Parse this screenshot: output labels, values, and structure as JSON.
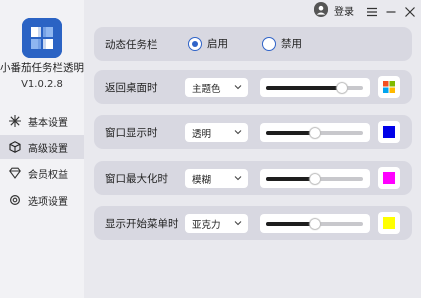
{
  "app": {
    "name": "小番茄任务栏透明",
    "version": "V1.0.2.8",
    "brand_color": "#2b63c4"
  },
  "titlebar": {
    "login_label": "登录",
    "icons": [
      "user-icon",
      "menu-icon",
      "minimize-icon",
      "close-icon"
    ]
  },
  "sidebar": {
    "items": [
      {
        "label": "基本设置",
        "icon": "sparkle-icon",
        "active": false
      },
      {
        "label": "高级设置",
        "icon": "cube-icon",
        "active": true
      },
      {
        "label": "会员权益",
        "icon": "diamond-icon",
        "active": false
      },
      {
        "label": "选项设置",
        "icon": "gear-icon",
        "active": false
      }
    ]
  },
  "main": {
    "dynamic_taskbar": {
      "label": "动态任务栏",
      "options": [
        {
          "label": "启用",
          "selected": true
        },
        {
          "label": "禁用",
          "selected": false
        }
      ]
    },
    "rows": [
      {
        "label": "返回桌面时",
        "select_value": "主题色",
        "slider_value": 0.78,
        "color": "theme",
        "color_icon": "windows-logo-icon"
      },
      {
        "label": "窗口显示时",
        "select_value": "透明",
        "slider_value": 0.5,
        "color": "#0000e8"
      },
      {
        "label": "窗口最大化时",
        "select_value": "模糊",
        "slider_value": 0.5,
        "color": "#ff00ff"
      },
      {
        "label": "显示开始菜单时",
        "select_value": "亚克力",
        "slider_value": 0.5,
        "color": "#ffff00"
      }
    ]
  },
  "colors": {
    "accent": "#2f63c8",
    "card_bg": "#d8d8e1",
    "window_bg": "#e9e9ee"
  }
}
